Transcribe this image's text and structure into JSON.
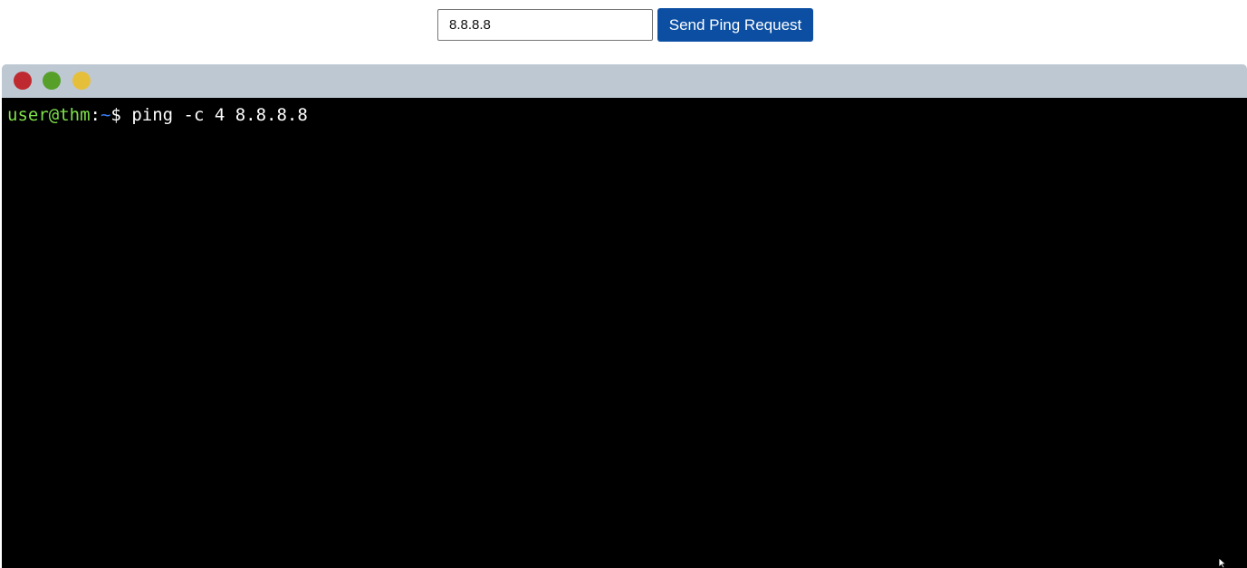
{
  "form": {
    "ip_value": "8.8.8.8",
    "submit_label": "Send Ping Request"
  },
  "terminal": {
    "window_controls": [
      "close-icon",
      "maximize-icon",
      "minimize-icon"
    ],
    "prompt": {
      "user_host": "user@thm",
      "separator": ":",
      "path": "~",
      "symbol": "$"
    },
    "command": "ping -c 4 8.8.8.8"
  },
  "colors": {
    "button": "#0b4ea2",
    "titlebar": "#bec8d2",
    "terminal_background": "#000000",
    "prompt_user": "#7ee04b",
    "prompt_path": "#3a7ff2",
    "close": "#bf2a30",
    "maximize": "#56a02a",
    "minimize": "#e6bf3a"
  }
}
